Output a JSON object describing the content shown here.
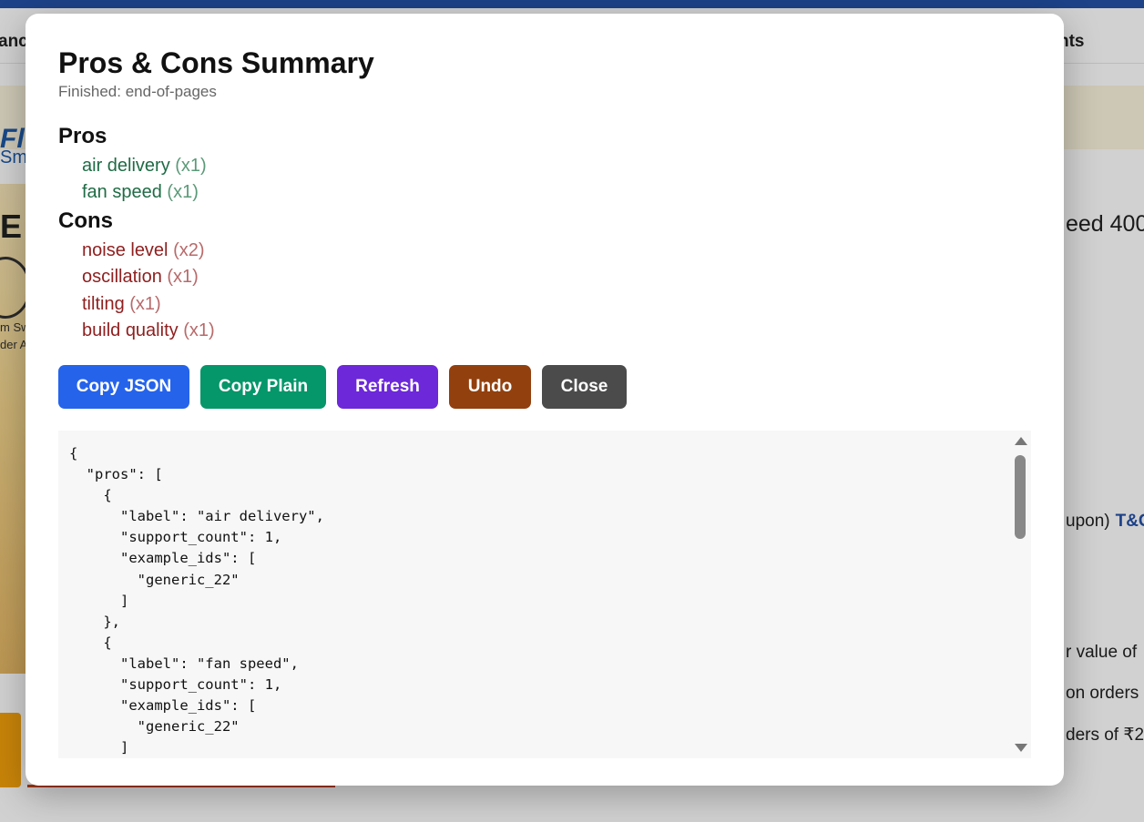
{
  "background": {
    "nav_left_fragment": "ance",
    "nav_right_fragment": "hts",
    "brand_fragment": "Fl",
    "brand_sub_fragment": "Sm",
    "promo_letter": "E",
    "promo_line1": "m Sw",
    "promo_line2": "der A",
    "speed_fragment": "eed 400",
    "coupon_fragment": "upon)",
    "tc_label": "T&C",
    "value_fragment": "r value of",
    "orders_fragment": "on orders",
    "orders2_fragment": "ders of ₹2"
  },
  "modal": {
    "title": "Pros & Cons Summary",
    "subtitle": "Finished: end-of-pages",
    "pros_heading": "Pros",
    "cons_heading": "Cons",
    "pros": [
      {
        "label": "air delivery",
        "count": "(x1)"
      },
      {
        "label": "fan speed",
        "count": "(x1)"
      }
    ],
    "cons": [
      {
        "label": "noise level",
        "count": "(x2)"
      },
      {
        "label": "oscillation",
        "count": "(x1)"
      },
      {
        "label": "tilting",
        "count": "(x1)"
      },
      {
        "label": "build quality",
        "count": "(x1)"
      }
    ],
    "buttons": {
      "copy_json": "Copy JSON",
      "copy_plain": "Copy Plain",
      "refresh": "Refresh",
      "undo": "Undo",
      "close": "Close"
    },
    "json_text": "{\n  \"pros\": [\n    {\n      \"label\": \"air delivery\",\n      \"support_count\": 1,\n      \"example_ids\": [\n        \"generic_22\"\n      ]\n    },\n    {\n      \"label\": \"fan speed\",\n      \"support_count\": 1,\n      \"example_ids\": [\n        \"generic_22\"\n      ]\n    },\n    {"
  },
  "colors": {
    "copy_json": "#2563eb",
    "copy_plain": "#059669",
    "refresh": "#6d28d9",
    "undo": "#92400e",
    "close": "#4b4b4b",
    "pro_text": "#1f6b45",
    "con_text": "#8f2020"
  },
  "icons": {
    "scroll_up": "triangle-up",
    "scroll_down": "triangle-down"
  }
}
